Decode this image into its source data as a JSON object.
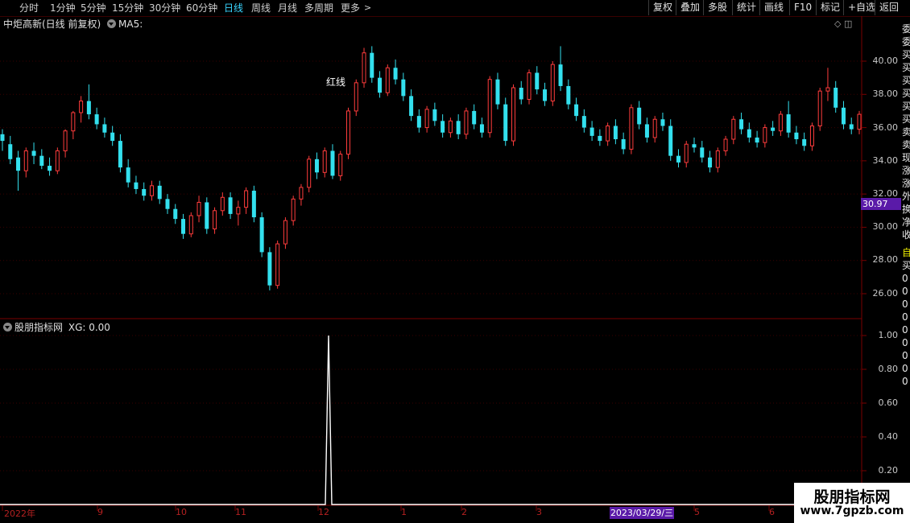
{
  "toolbar": {
    "periods": [
      "分时",
      "1分钟",
      "5分钟",
      "15分钟",
      "30分钟",
      "60分钟",
      "日线",
      "周线",
      "月线",
      "多周期",
      "更多"
    ],
    "active_period": "日线",
    "more_caret": ">",
    "right_buttons": [
      "复权",
      "叠加",
      "多股",
      "统计",
      "画线",
      "F10",
      "标记",
      "+自选",
      "返回"
    ]
  },
  "main_pane": {
    "title": "中炬高新(日线 前复权)",
    "ma_label": "MA5:",
    "price_axis": [
      "40.00",
      "38.00",
      "36.00",
      "34.00",
      "32.00",
      "30.00",
      "28.00",
      "26.00"
    ],
    "current_price_tag": "30.97",
    "annotation": "红线",
    "corner_icons": "◇ ◫"
  },
  "indicator_pane": {
    "title": "股朋指标网",
    "value_label": "XG: 0.00",
    "axis": [
      "1.00",
      "0.80",
      "0.60",
      "0.40",
      "0.20"
    ]
  },
  "x_axis": {
    "labels": [
      "2022年",
      "9",
      "10",
      "11",
      "12",
      "1",
      "2",
      "3",
      "5",
      "6"
    ],
    "cursor_date": "2023/03/29/三"
  },
  "right_strip_chars": [
    "委",
    "委",
    "买",
    "买",
    "买",
    "买",
    "买",
    "买",
    "卖",
    "卖",
    "现",
    "涨",
    "涨",
    "外",
    "换",
    "净",
    "收"
  ],
  "right_strip_lower_chars": [
    "自",
    "买",
    "0",
    "0",
    "0",
    "0",
    "0",
    "0",
    "0",
    "0",
    "0"
  ],
  "watermark": {
    "title": "股朋指标网",
    "url": "www.7gpzb.com"
  },
  "colors": {
    "up": "#ff3c3c",
    "down": "#33e0ee",
    "grid": "#5a0000",
    "active": "#39d5ff",
    "tag": "#5a1aa8"
  },
  "chart_data": {
    "type": "candlestick",
    "price_range": [
      25.3,
      41.5
    ],
    "xg_signal": {
      "values": [
        0,
        1,
        0
      ],
      "range": [
        0,
        1.05
      ]
    },
    "candles": [
      [
        35.6,
        35.9,
        34.6,
        35.2
      ],
      [
        35.0,
        35.5,
        33.8,
        34.1
      ],
      [
        34.2,
        34.6,
        32.2,
        33.4
      ],
      [
        33.4,
        34.8,
        33.0,
        34.6
      ],
      [
        34.6,
        35.1,
        33.8,
        34.3
      ],
      [
        34.3,
        34.7,
        33.5,
        33.7
      ],
      [
        33.7,
        34.2,
        33.1,
        33.4
      ],
      [
        33.4,
        34.8,
        33.2,
        34.6
      ],
      [
        34.6,
        35.9,
        34.2,
        35.8
      ],
      [
        35.8,
        37.0,
        35.3,
        36.9
      ],
      [
        36.9,
        37.9,
        36.3,
        37.6
      ],
      [
        37.6,
        38.6,
        36.5,
        36.8
      ],
      [
        36.8,
        37.2,
        35.9,
        36.2
      ],
      [
        36.2,
        36.6,
        35.4,
        35.7
      ],
      [
        35.7,
        36.1,
        34.9,
        35.2
      ],
      [
        35.2,
        35.6,
        33.3,
        33.6
      ],
      [
        33.6,
        34.1,
        32.4,
        32.7
      ],
      [
        32.7,
        33.1,
        32.0,
        32.3
      ],
      [
        32.3,
        32.7,
        31.6,
        31.9
      ],
      [
        31.9,
        32.8,
        31.6,
        32.5
      ],
      [
        32.5,
        32.8,
        31.4,
        31.7
      ],
      [
        31.7,
        32.0,
        30.8,
        31.1
      ],
      [
        31.1,
        31.4,
        30.2,
        30.5
      ],
      [
        30.5,
        30.8,
        29.3,
        29.6
      ],
      [
        29.6,
        30.9,
        29.4,
        30.7
      ],
      [
        30.7,
        31.9,
        30.3,
        31.5
      ],
      [
        31.5,
        31.8,
        29.6,
        29.9
      ],
      [
        29.9,
        31.2,
        29.6,
        31.0
      ],
      [
        31.0,
        32.1,
        30.7,
        31.8
      ],
      [
        31.8,
        32.1,
        30.5,
        30.8
      ],
      [
        30.8,
        31.6,
        30.1,
        31.2
      ],
      [
        31.2,
        32.4,
        30.8,
        32.2
      ],
      [
        32.2,
        32.5,
        30.3,
        30.6
      ],
      [
        30.6,
        30.9,
        28.2,
        28.5
      ],
      [
        28.5,
        28.8,
        26.2,
        26.5
      ],
      [
        26.5,
        29.2,
        26.3,
        29.0
      ],
      [
        29.0,
        30.6,
        28.7,
        30.4
      ],
      [
        30.4,
        31.9,
        30.1,
        31.7
      ],
      [
        31.7,
        32.6,
        31.3,
        32.4
      ],
      [
        32.4,
        34.3,
        32.1,
        34.1
      ],
      [
        34.1,
        34.5,
        32.9,
        33.3
      ],
      [
        33.3,
        34.8,
        33.0,
        34.6
      ],
      [
        34.6,
        35.0,
        32.9,
        33.1
      ],
      [
        33.1,
        34.6,
        32.8,
        34.4
      ],
      [
        34.4,
        37.2,
        34.1,
        37.0
      ],
      [
        37.0,
        38.9,
        36.7,
        38.7
      ],
      [
        38.7,
        40.8,
        38.4,
        40.5
      ],
      [
        40.5,
        40.9,
        38.7,
        39.0
      ],
      [
        39.0,
        39.4,
        37.8,
        38.1
      ],
      [
        38.1,
        39.8,
        37.9,
        39.6
      ],
      [
        39.6,
        40.1,
        38.6,
        38.9
      ],
      [
        38.9,
        39.3,
        37.6,
        37.9
      ],
      [
        37.9,
        38.3,
        36.4,
        36.7
      ],
      [
        36.7,
        37.1,
        35.7,
        36.0
      ],
      [
        36.0,
        37.3,
        35.7,
        37.1
      ],
      [
        37.1,
        37.5,
        36.1,
        36.4
      ],
      [
        36.4,
        36.8,
        35.4,
        35.7
      ],
      [
        35.7,
        36.6,
        35.4,
        36.4
      ],
      [
        36.4,
        36.8,
        35.3,
        35.6
      ],
      [
        35.6,
        37.2,
        35.3,
        37.0
      ],
      [
        37.0,
        37.4,
        35.9,
        36.2
      ],
      [
        36.2,
        36.6,
        35.4,
        35.7
      ],
      [
        35.7,
        39.1,
        35.4,
        38.9
      ],
      [
        38.9,
        39.3,
        37.1,
        37.4
      ],
      [
        37.4,
        37.8,
        34.9,
        35.2
      ],
      [
        35.2,
        38.6,
        34.9,
        38.4
      ],
      [
        38.4,
        38.8,
        37.4,
        37.7
      ],
      [
        37.7,
        39.5,
        37.4,
        39.3
      ],
      [
        39.3,
        39.7,
        38.0,
        38.3
      ],
      [
        38.3,
        38.7,
        37.3,
        37.6
      ],
      [
        37.6,
        40.0,
        37.3,
        39.8
      ],
      [
        39.8,
        40.9,
        38.2,
        38.5
      ],
      [
        38.5,
        38.9,
        37.1,
        37.4
      ],
      [
        37.4,
        37.8,
        36.4,
        36.7
      ],
      [
        36.7,
        37.1,
        35.7,
        36.0
      ],
      [
        36.0,
        36.4,
        35.2,
        35.5
      ],
      [
        35.5,
        35.9,
        34.9,
        35.2
      ],
      [
        35.2,
        36.3,
        34.9,
        36.1
      ],
      [
        36.1,
        36.5,
        35.0,
        35.3
      ],
      [
        35.3,
        35.7,
        34.4,
        34.7
      ],
      [
        34.7,
        37.4,
        34.4,
        37.2
      ],
      [
        37.2,
        37.6,
        35.9,
        36.2
      ],
      [
        36.2,
        36.6,
        35.1,
        35.4
      ],
      [
        35.4,
        36.7,
        35.1,
        36.5
      ],
      [
        36.5,
        36.9,
        35.8,
        36.1
      ],
      [
        36.1,
        36.5,
        34.0,
        34.3
      ],
      [
        34.3,
        34.7,
        33.6,
        33.9
      ],
      [
        33.9,
        35.2,
        33.6,
        35.0
      ],
      [
        35.0,
        35.4,
        34.5,
        34.8
      ],
      [
        34.8,
        35.2,
        33.9,
        34.2
      ],
      [
        34.2,
        34.6,
        33.3,
        33.6
      ],
      [
        33.6,
        34.8,
        33.3,
        34.6
      ],
      [
        34.6,
        35.5,
        34.3,
        35.3
      ],
      [
        35.3,
        36.7,
        35.0,
        36.5
      ],
      [
        36.5,
        36.9,
        35.6,
        35.9
      ],
      [
        35.9,
        36.3,
        35.1,
        35.4
      ],
      [
        35.4,
        35.8,
        34.8,
        35.1
      ],
      [
        35.1,
        36.2,
        34.8,
        36.0
      ],
      [
        36.0,
        36.4,
        35.5,
        35.8
      ],
      [
        35.8,
        37.0,
        35.5,
        36.8
      ],
      [
        36.8,
        37.6,
        35.4,
        35.7
      ],
      [
        35.7,
        36.1,
        35.0,
        35.3
      ],
      [
        35.3,
        35.7,
        34.6,
        34.9
      ],
      [
        34.9,
        36.3,
        34.6,
        36.1
      ],
      [
        36.1,
        38.4,
        35.8,
        38.2
      ],
      [
        38.2,
        39.6,
        37.6,
        38.4
      ],
      [
        38.4,
        38.8,
        36.9,
        37.2
      ],
      [
        37.2,
        37.6,
        35.9,
        36.2
      ],
      [
        36.2,
        36.6,
        35.6,
        35.9
      ],
      [
        35.9,
        37.0,
        35.6,
        36.8
      ]
    ]
  }
}
